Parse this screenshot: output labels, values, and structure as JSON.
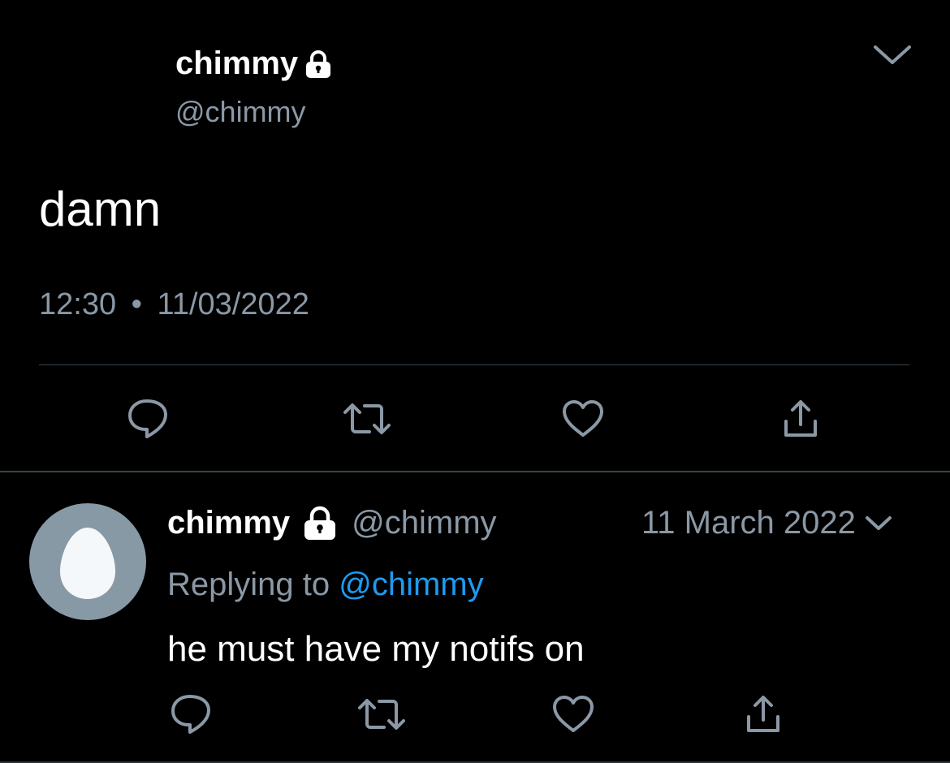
{
  "main_tweet": {
    "display_name": "chimmy",
    "handle": "@chimmy",
    "text": "damn",
    "time": "12:30",
    "separator": "•",
    "date": "11/03/2022",
    "protected_icon": "lock-icon",
    "menu_icon": "chevron-down-icon",
    "actions": [
      "reply-icon",
      "retweet-icon",
      "like-icon",
      "share-icon"
    ]
  },
  "reply": {
    "display_name": "chimmy",
    "handle": "@chimmy",
    "date": "11 March 2022",
    "replying_prefix": "Replying to",
    "replying_handle": "@chimmy",
    "text": "he must have my notifs on",
    "avatar_icon": "default-egg-avatar",
    "protected_icon": "lock-icon",
    "menu_icon": "chevron-down-icon",
    "actions": [
      "reply-icon",
      "retweet-icon",
      "like-icon",
      "share-icon"
    ]
  },
  "colors": {
    "background": "#000000",
    "text": "#ffffff",
    "muted": "#8b98a5",
    "link": "#1d9bf0",
    "divider": "#38444d",
    "avatar_bg": "#8899a6",
    "egg": "#f5f8fa"
  }
}
